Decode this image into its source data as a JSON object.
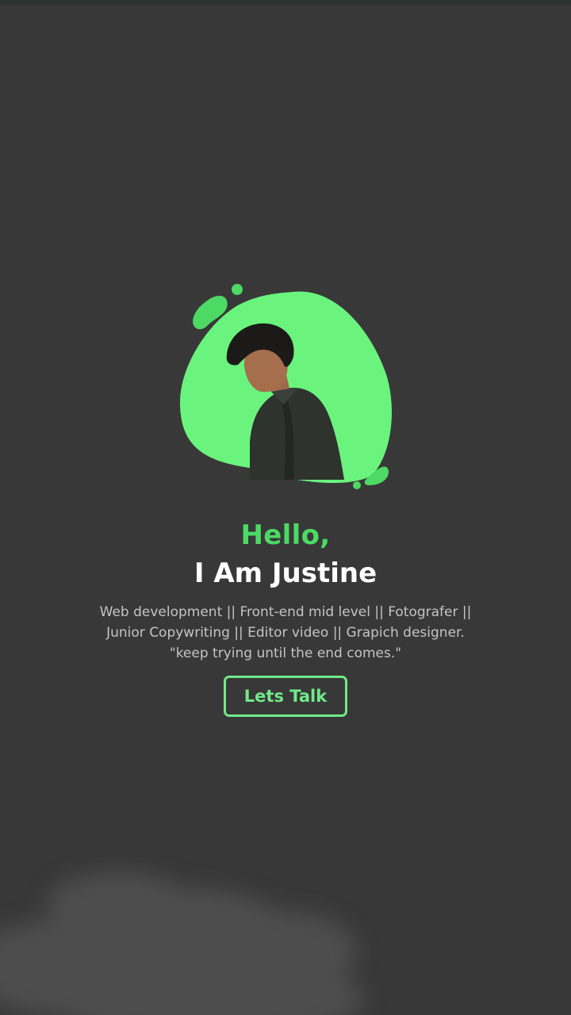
{
  "theme": {
    "background": "#383838",
    "accent": "#4cd964",
    "blob": "#6af47e",
    "button_border": "#71e98a",
    "text_primary": "#ffffff",
    "text_secondary": "#c4c4c4"
  },
  "hero": {
    "greeting": "Hello,",
    "name": "I Am Justine",
    "bio_lines": [
      "Web development || Front-end mid level || Fotografer ||",
      "Junior Copywriting || Editor video || Grapich designer.",
      "\"keep trying until the end comes.\""
    ],
    "cta_label": "Lets Talk"
  }
}
